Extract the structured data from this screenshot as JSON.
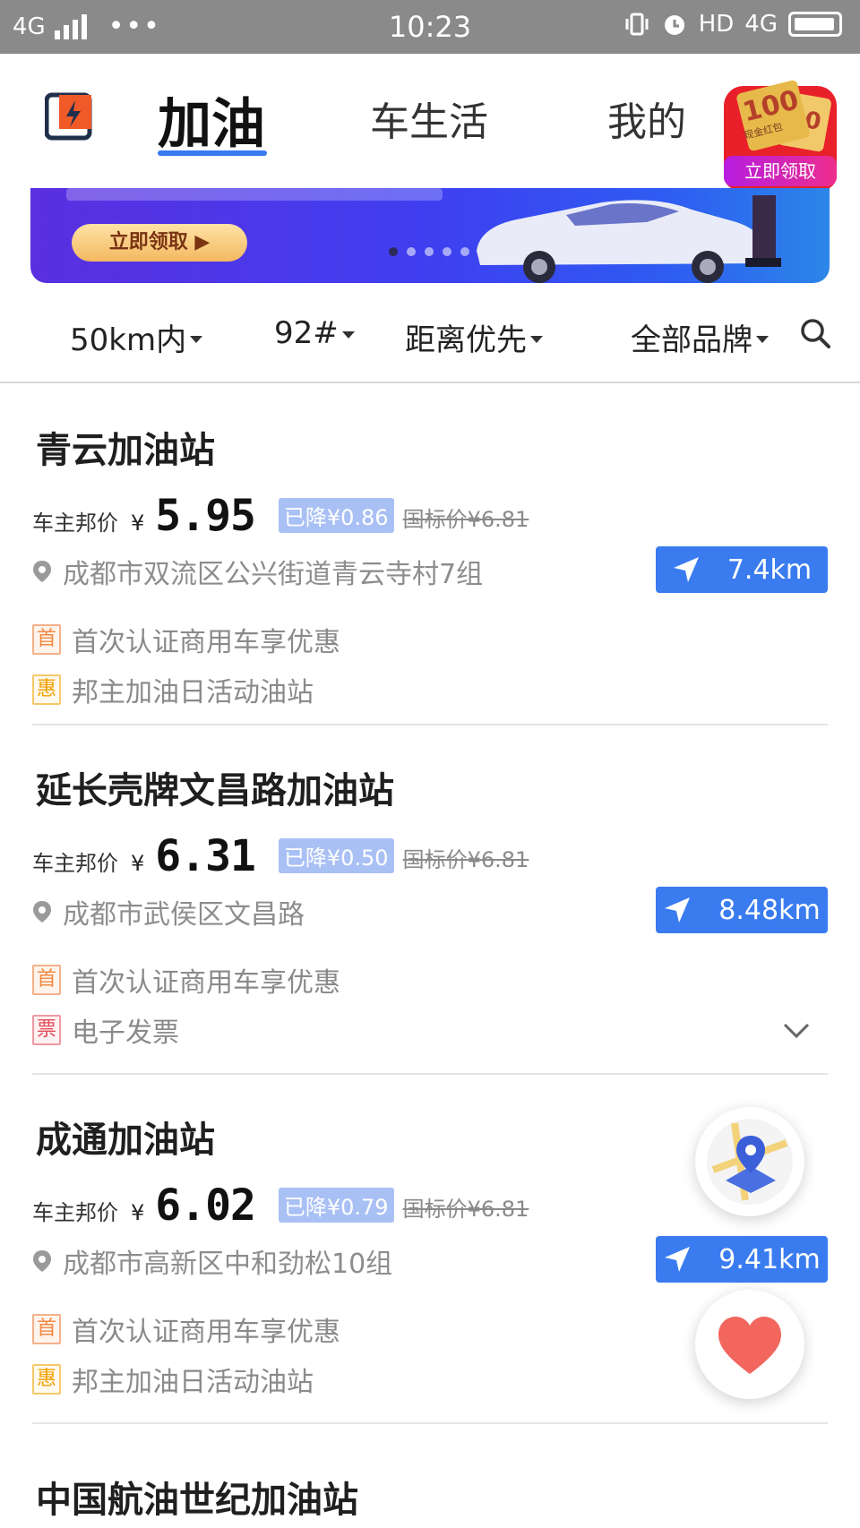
{
  "status_bar": {
    "network": "4G",
    "dots": "•••",
    "time": "10:23",
    "right_label": "HD",
    "right_network": "4G"
  },
  "header": {
    "tabs": [
      {
        "label": "加油",
        "active": true
      },
      {
        "label": "车生活",
        "active": false
      },
      {
        "label": "我的",
        "active": false
      }
    ],
    "red_packet": {
      "amount": "100",
      "amount2": "00",
      "sub": "现金红包",
      "button": "立即领取"
    }
  },
  "banner": {
    "button": "立即领取 ▶",
    "dots": 5,
    "active_dot": 0
  },
  "filters": [
    {
      "label": "50km内"
    },
    {
      "label": "92#"
    },
    {
      "label": "距离优先"
    },
    {
      "label": "全部品牌"
    }
  ],
  "price_label": "车主邦价",
  "yen": "¥",
  "stations": [
    {
      "name": "青云加油站",
      "price": "5.95",
      "drop": "已降¥0.86",
      "std": "国标价¥6.81",
      "address": "成都市双流区公兴街道青云寺村7组",
      "distance": "7.4km",
      "promos": [
        {
          "tag": "首",
          "text": "首次认证商用车享优惠",
          "kind": "shou"
        },
        {
          "tag": "惠",
          "text": "邦主加油日活动油站",
          "kind": "hui"
        }
      ]
    },
    {
      "name": "延长壳牌文昌路加油站",
      "price": "6.31",
      "drop": "已降¥0.50",
      "std": "国标价¥6.81",
      "address": "成都市武侯区文昌路",
      "distance": "8.48km",
      "promos": [
        {
          "tag": "首",
          "text": "首次认证商用车享优惠",
          "kind": "shou"
        },
        {
          "tag": "票",
          "text": "电子发票",
          "kind": "piao"
        }
      ]
    },
    {
      "name": "成通加油站",
      "price": "6.02",
      "drop": "已降¥0.79",
      "std": "国标价¥6.81",
      "address": "成都市高新区中和劲松10组",
      "distance": "9.41km",
      "promos": [
        {
          "tag": "首",
          "text": "首次认证商用车享优惠",
          "kind": "shou"
        },
        {
          "tag": "惠",
          "text": "邦主加油日活动油站",
          "kind": "hui"
        }
      ]
    },
    {
      "name": "中国航油世纪加油站"
    }
  ],
  "colors": {
    "accent": "#3a7cf0",
    "drop_badge": "#a9c0f5",
    "heart": "#f2665e"
  },
  "icons": {
    "logo": "fuel-app-logo",
    "search": "search-icon",
    "pin": "location-pin-icon",
    "nav": "navigation-arrow-icon",
    "expand": "chevron-down-icon",
    "map": "map-location-icon",
    "favorite": "heart-icon"
  }
}
